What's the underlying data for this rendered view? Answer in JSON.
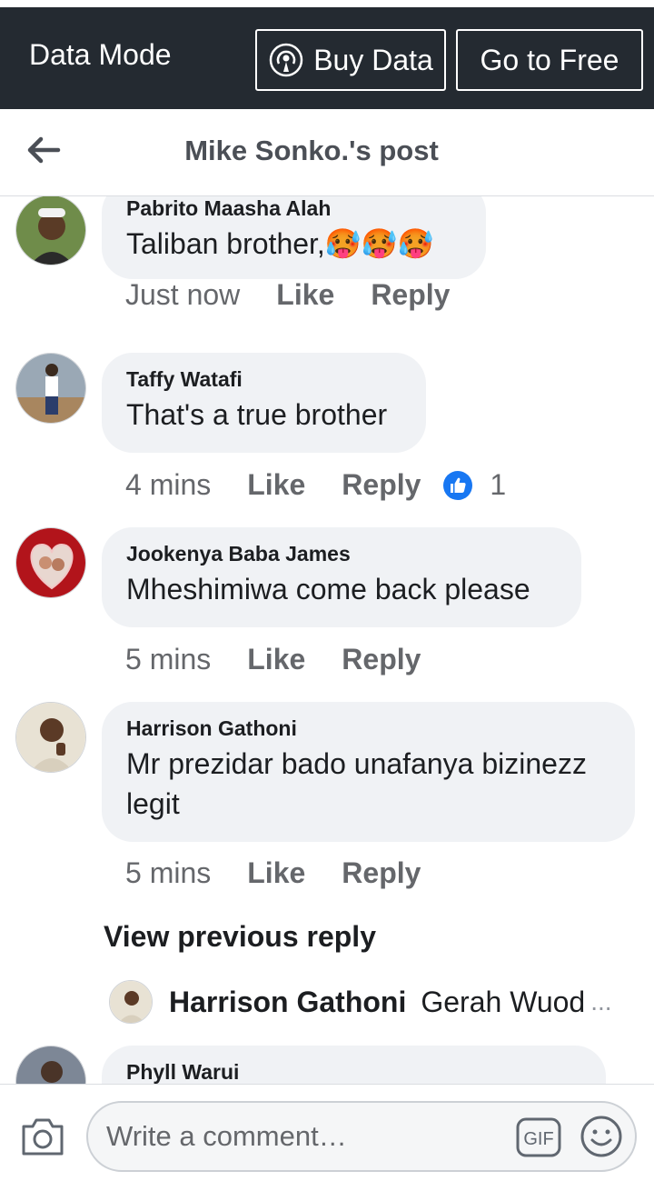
{
  "databar": {
    "mode_label": "Data Mode",
    "buy_label": "Buy Data",
    "free_label": "Go to Free"
  },
  "header": {
    "title": "Mike Sonko.'s post"
  },
  "comments": [
    {
      "author": "Pabrito Maasha Alah",
      "text": "Taliban brother,🥵🥵🥵",
      "time": "Just now",
      "like": "Like",
      "reply": "Reply",
      "avatar_color": "#7a8a5a"
    },
    {
      "author": "Taffy Watafi",
      "text": "That's a true brother",
      "time": "4 mins",
      "like": "Like",
      "reply": "Reply",
      "reaction_count": "1",
      "avatar_color": "#8f9aa5"
    },
    {
      "author": "Jookenya Baba James",
      "text": "Mheshimiwa come back please",
      "time": "5 mins",
      "like": "Like",
      "reply": "Reply",
      "avatar_color": "#b2141b"
    },
    {
      "author": "Harrison Gathoni",
      "text": "Mr prezidar bado unafanya bizinezz legit",
      "time": "5 mins",
      "like": "Like",
      "reply": "Reply",
      "avatar_color": "#d9d2c2"
    },
    {
      "author": "Phyll Warui",
      "avatar_color": "#5f6b7a"
    }
  ],
  "replies": {
    "view_previous": "View previous reply",
    "preview_author": "Harrison Gathoni",
    "preview_text": "Gerah Wuod",
    "preview_ellipsis": "..."
  },
  "composer": {
    "placeholder": "Write a comment…",
    "gif_label": "GIF"
  },
  "colors": {
    "databar_bg": "#242a31",
    "bubble_bg": "#f0f2f5",
    "like_blue": "#1877f2"
  }
}
